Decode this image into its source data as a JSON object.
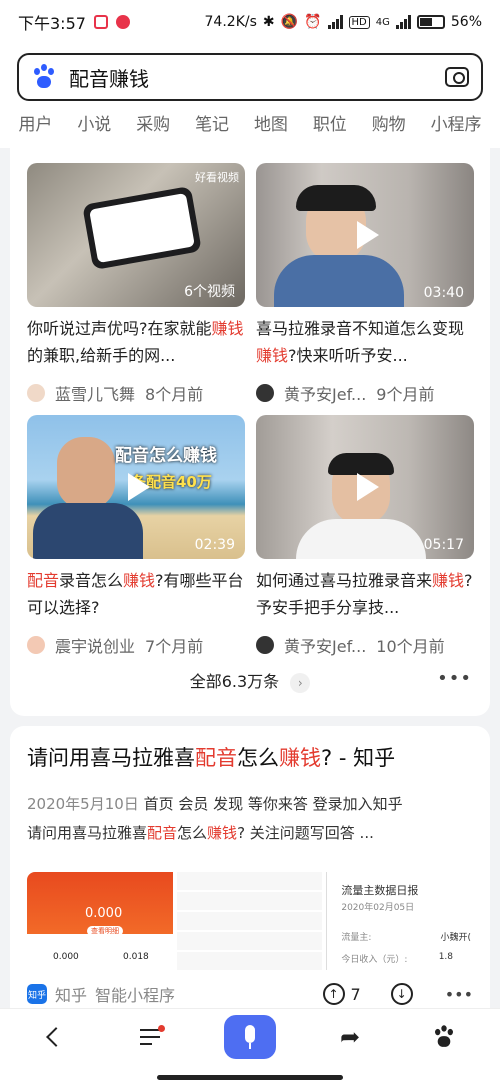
{
  "status": {
    "time": "下午3:57",
    "speed": "74.2K/s",
    "network": "4G",
    "battery": "56",
    "battery_suffix": "%",
    "hd": "HD"
  },
  "search": {
    "query": "配音赚钱"
  },
  "tabs": [
    "用户",
    "小说",
    "采购",
    "笔记",
    "地图",
    "职位",
    "购物",
    "小程序"
  ],
  "videos": [
    {
      "badge": "6个视频",
      "title_parts": [
        "你听说过声优吗?在家就能",
        "赚钱",
        "的兼职,给新手的网..."
      ],
      "author": "蓝雪儿飞舞",
      "time": "8个月前"
    },
    {
      "badge": "03:40",
      "title_parts": [
        "喜马拉雅录音不知道怎么变现",
        "赚钱",
        "?快来听听予安..."
      ],
      "author": "黄予安Jef...",
      "time": "9个月前"
    },
    {
      "badge": "02:39",
      "overlay_line1": "配音怎么赚钱",
      "overlay_line2": "条配音40万",
      "title_parts": [
        "配音",
        "录音怎么",
        "赚钱",
        "?有哪些平台可以选择?"
      ],
      "author": "震宇说创业",
      "time": "7个月前"
    },
    {
      "badge": "05:17",
      "title_parts": [
        "如何通过喜马拉雅录音来",
        "赚钱",
        "?予安手把手分享技..."
      ],
      "author": "黄予安Jef...",
      "time": "10个月前"
    }
  ],
  "view_all": "全部6.3万条",
  "thumb_watermark": "好看视频",
  "result": {
    "title_pre": "请问用喜马拉雅喜",
    "title_red1": "配音",
    "title_mid": "怎么",
    "title_red2": "赚钱",
    "title_post": "? - 知乎",
    "date": "2020年5月10日",
    "desc1": " 首页 会员 发现 等你来答  登录加入知乎",
    "desc2_pre": "请问用喜马拉雅喜",
    "desc2_red1": "配音",
    "desc2_mid": "怎么",
    "desc2_red2": "赚钱",
    "desc2_post": "? 关注问题写回答 ...",
    "images": {
      "img1_value1": "0.000",
      "img1_button": "查看明细",
      "img1_small1": "0.000",
      "img1_small2": "0.018",
      "img3_title": "流量主数据日报",
      "img3_date": "2020年02月05日",
      "img3_row1_label": "流量主:",
      "img3_row1_value": "小魏开(",
      "img3_row2_label": "今日收入（元）:",
      "img3_row2_value": "1.8"
    },
    "source_logo": "知乎",
    "source": "知乎",
    "source_type": "智能小程序",
    "upvotes": "7"
  },
  "colors": {
    "accent": "#4e6ef2",
    "highlight": "#e33b2f"
  }
}
